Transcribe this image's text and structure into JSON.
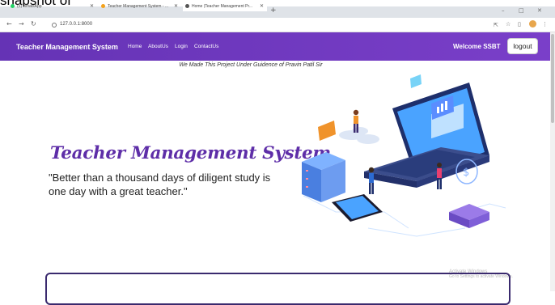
{
  "caption": "snapshot of application:",
  "browser": {
    "tabs": [
      {
        "label": "(5) WhatsApp",
        "favicon_color": "#25d366"
      },
      {
        "label": "Teacher Management System - ...",
        "favicon_color": "#f4a21c"
      },
      {
        "label": "Home (Teacher Management Pr...",
        "favicon_color": "#555555"
      }
    ],
    "url": "127.0.0.1:8000"
  },
  "nav": {
    "brand": "Teacher Management System",
    "links": [
      "Home",
      "AboutUs",
      "Login",
      "ContactUs"
    ],
    "welcome": "Welcome SSBT",
    "logout": "logout"
  },
  "page": {
    "guidance": "We Made This Project Under Guidence of Pravin Patil Sir",
    "hero_title": "Teacher Management System",
    "quote": "\"Better than a thousand days of diligent study is one day with a great teacher.\""
  },
  "watermark": {
    "line1": "Activate Windows",
    "line2": "Go to Settings to activate Windows."
  },
  "colors": {
    "nav_start": "#6533b5",
    "nav_end": "#7a3fc9",
    "title": "#5e2ea8"
  }
}
